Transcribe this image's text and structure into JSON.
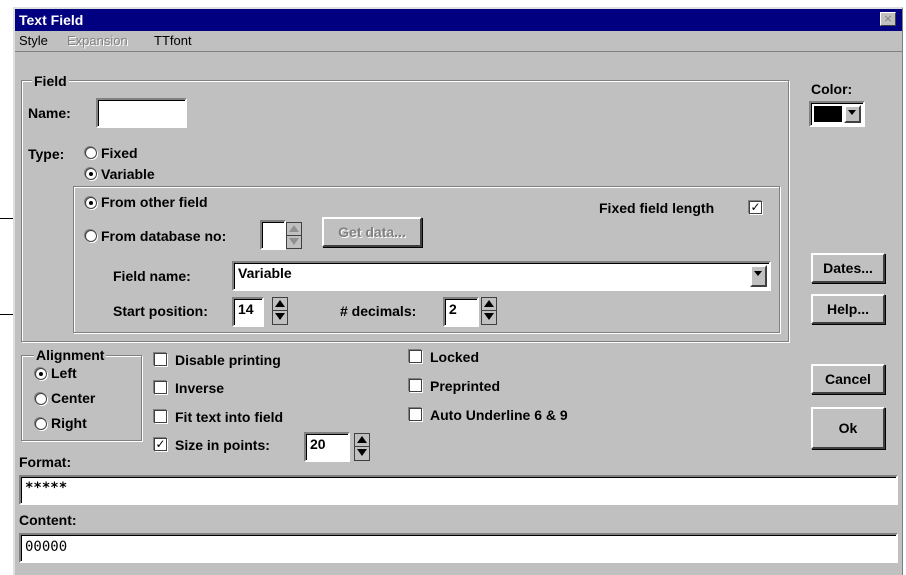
{
  "window": {
    "title": "Text Field",
    "close_glyph": "×"
  },
  "menu": {
    "items": [
      {
        "label": "Style"
      },
      {
        "label": "Expansion",
        "disabled": true
      },
      {
        "label": "TTfont"
      }
    ]
  },
  "field_group": {
    "legend": "Field",
    "name_label": "Name:",
    "name_value": "",
    "type_label": "Type:",
    "type_fixed": "Fixed",
    "type_variable": "Variable",
    "selected_type": "Variable",
    "variable_group": {
      "from_other_field": "From other field",
      "from_database": "From database no:",
      "selected_source": "From other field",
      "database_no_value": "",
      "get_data_label": "Get data...",
      "fixed_length_label": "Fixed field length",
      "fixed_length_checked": true,
      "field_name_label": "Field name:",
      "field_name_value": "Variable",
      "start_position_label": "Start position:",
      "start_position_value": "14",
      "decimals_label": "# decimals:",
      "decimals_value": "2"
    }
  },
  "color": {
    "label": "Color:",
    "swatch": "#000000"
  },
  "buttons": {
    "dates": "Dates...",
    "help": "Help...",
    "cancel": "Cancel",
    "ok": "Ok"
  },
  "alignment": {
    "legend": "Alignment",
    "left": "Left",
    "center": "Center",
    "right": "Right",
    "selected": "Left"
  },
  "options": {
    "disable_printing": {
      "label": "Disable printing",
      "checked": false
    },
    "inverse": {
      "label": "Inverse",
      "checked": false
    },
    "fit_text": {
      "label": "Fit text into field",
      "checked": false
    },
    "size_in_points": {
      "label": "Size in points:",
      "checked": true,
      "value": "20"
    },
    "locked": {
      "label": "Locked",
      "checked": false
    },
    "preprinted": {
      "label": "Preprinted",
      "checked": false
    },
    "auto_underline": {
      "label": "Auto Underline 6 & 9",
      "checked": false
    }
  },
  "format": {
    "label": "Format:",
    "value": "*****"
  },
  "content": {
    "label": "Content:",
    "value": "00000"
  },
  "check_glyph": "✓"
}
